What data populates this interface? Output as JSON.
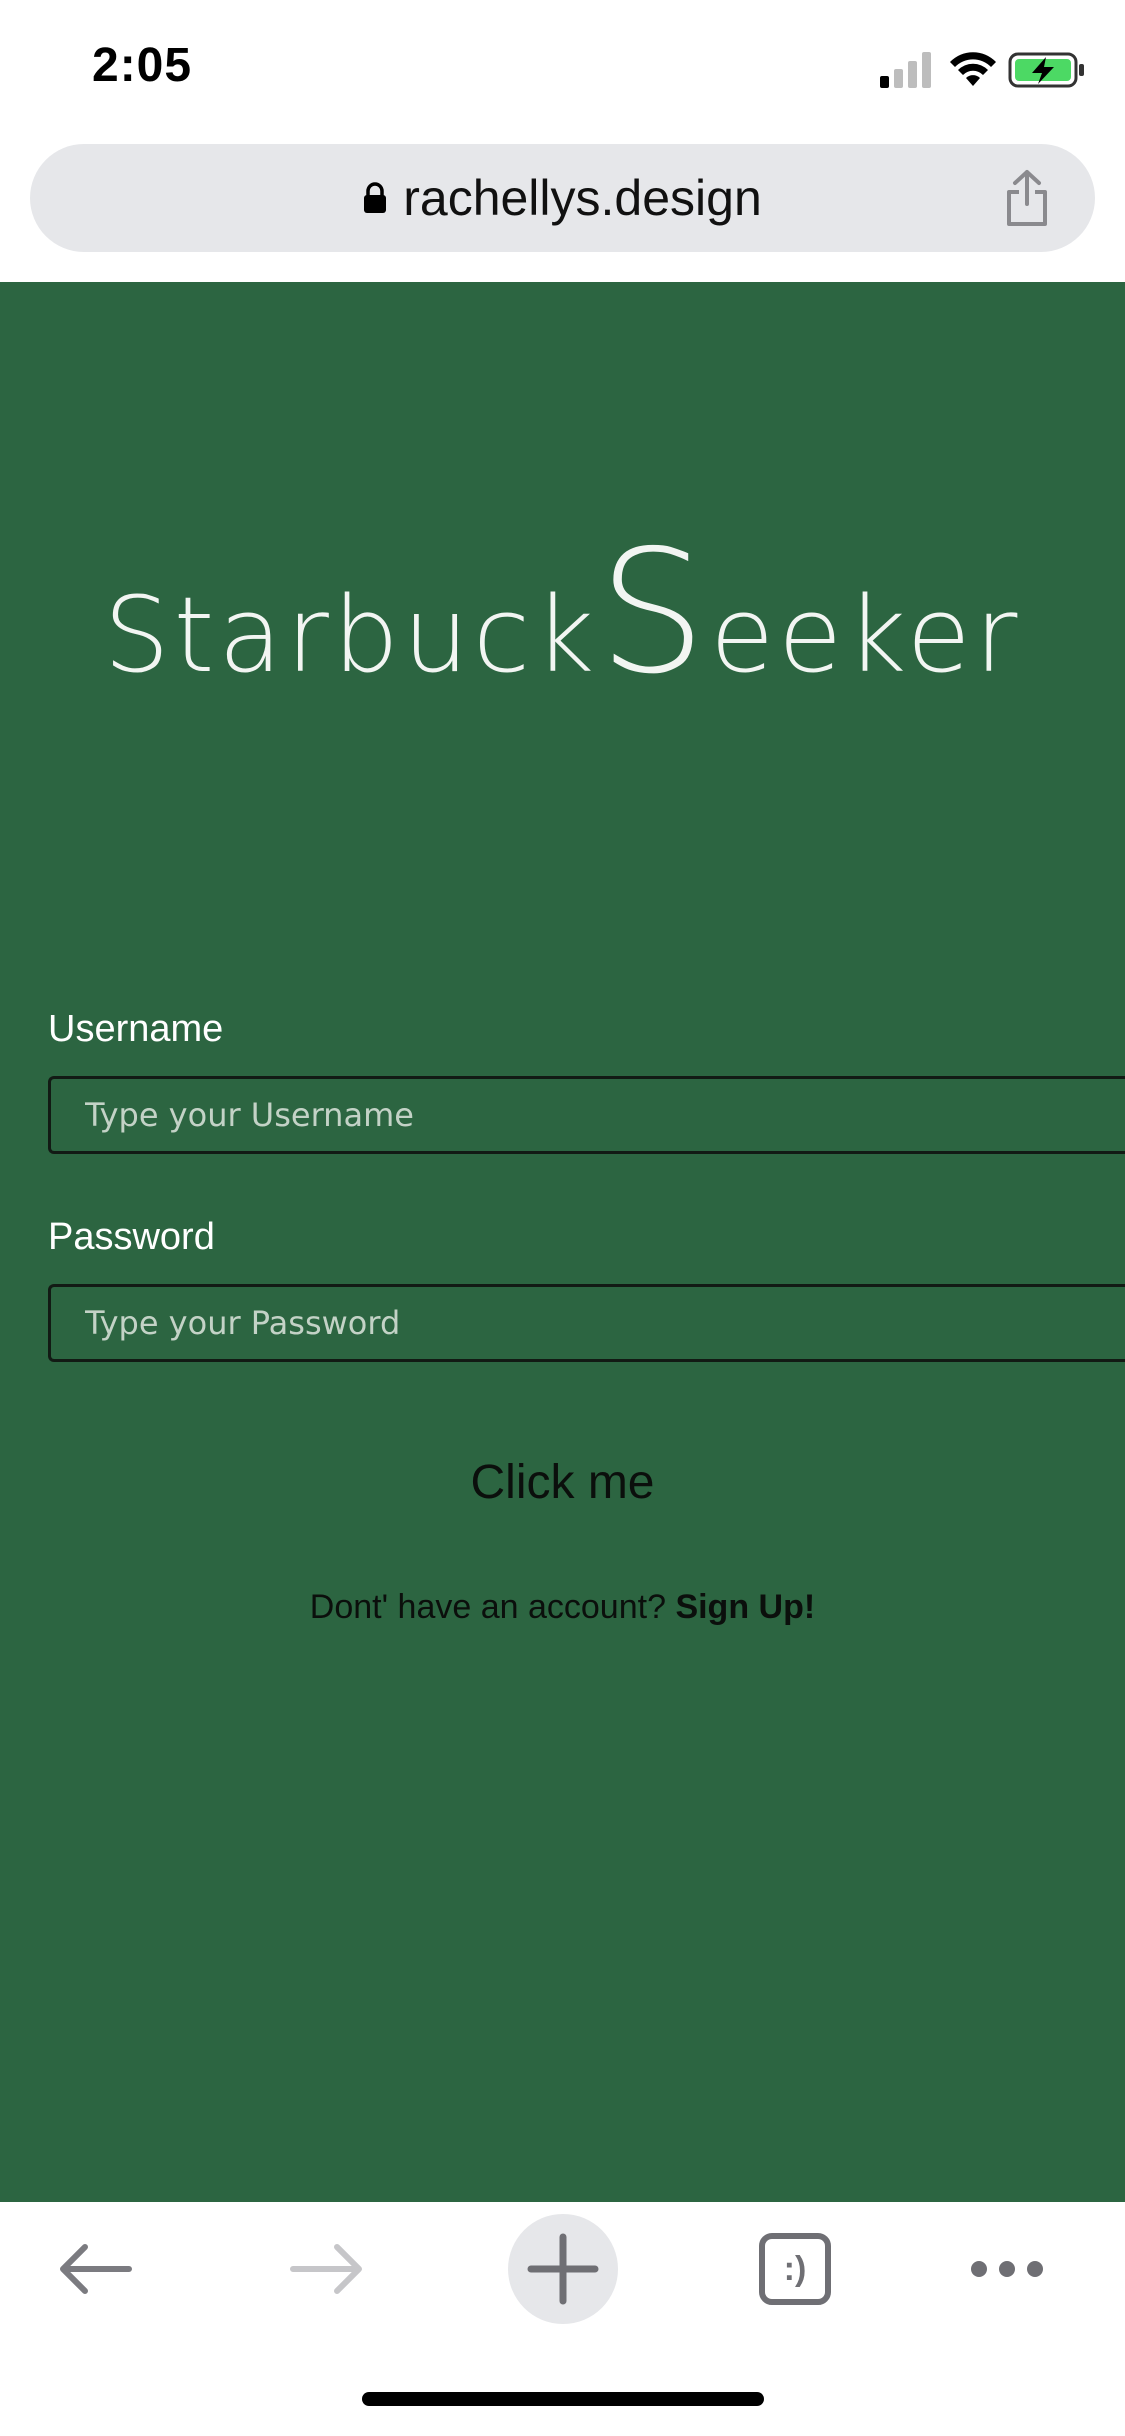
{
  "status_bar": {
    "time": "2:05"
  },
  "browser": {
    "url": "rachellys.design"
  },
  "app": {
    "logo": {
      "part1": "Starbuck",
      "big_letter": "S",
      "part2": "eeker"
    },
    "colors": {
      "background": "#2c6541",
      "text_light": "#ffffff"
    },
    "form": {
      "username_label": "Username",
      "username_placeholder": "Type your Username",
      "username_value": "",
      "password_label": "Password",
      "password_placeholder": "Type your Password",
      "password_value": "",
      "submit_label": "Click me"
    },
    "signup": {
      "prompt": "Dont' have an account? ",
      "link_label": "Sign Up!"
    }
  },
  "toolbar": {
    "icons": [
      "back-arrow-icon",
      "forward-arrow-icon",
      "plus-icon",
      "tabs-icon",
      "more-icon"
    ],
    "tabs_icon_glyph": ":)"
  }
}
